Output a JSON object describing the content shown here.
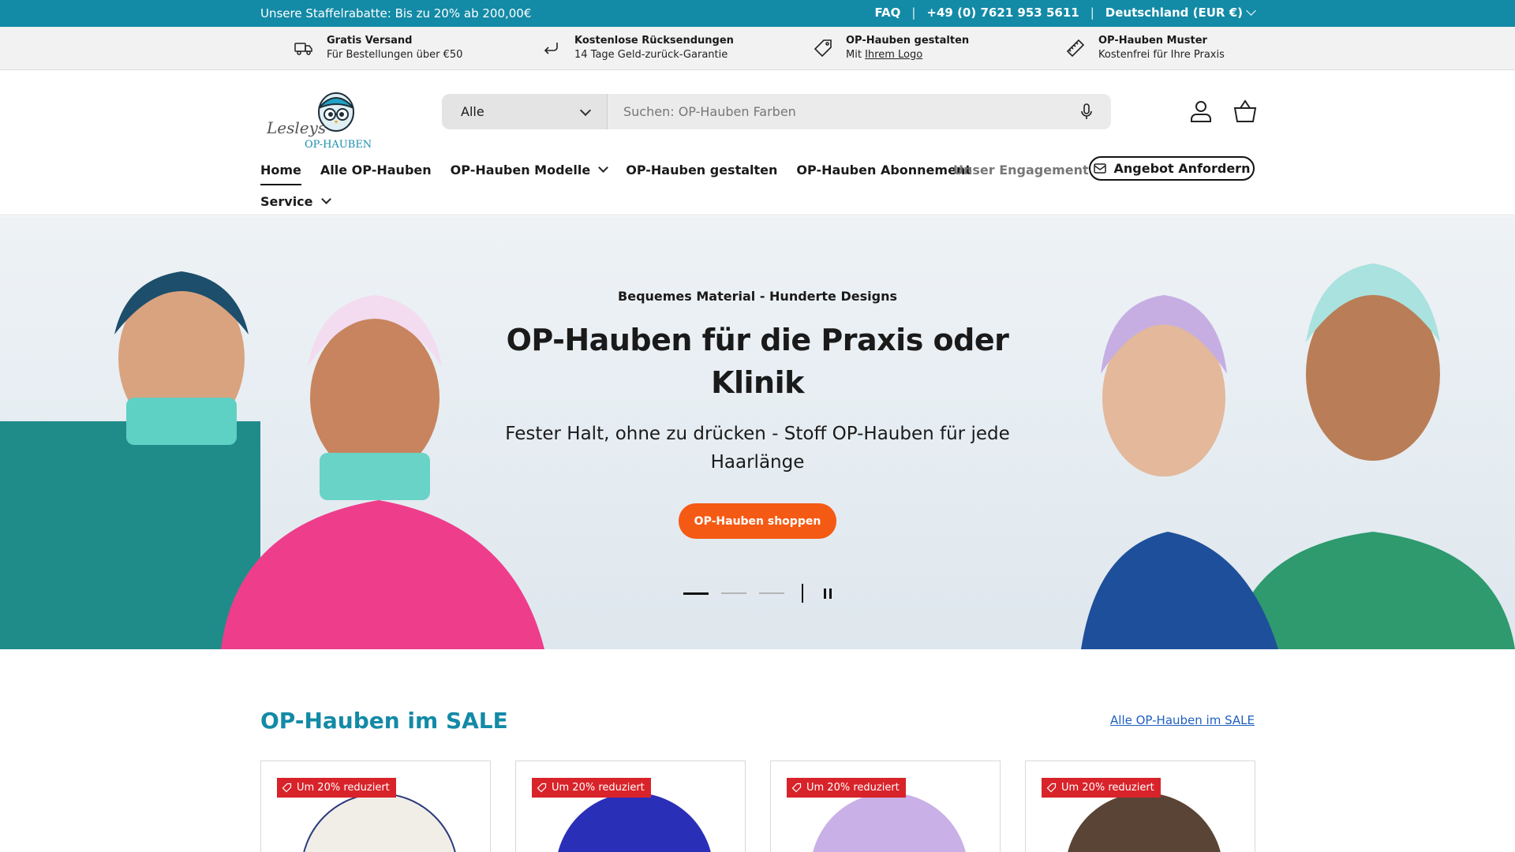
{
  "announcement": {
    "left_text": "Unsere Staffelrabatte: Bis zu 20% ab 200,00€",
    "faq": "FAQ",
    "phone": "+49 (0) 7621 953 5611",
    "country": "Deutschland (EUR €)",
    "separator": "|"
  },
  "usp": [
    {
      "icon": "truck-icon",
      "title": "Gratis Versand",
      "sub": "Für Bestellungen über €50"
    },
    {
      "icon": "return-arrow-icon",
      "title": "Kostenlose Rücksendungen",
      "sub": "14 Tage Geld-zurück-Garantie"
    },
    {
      "icon": "tag-icon",
      "title": "OP-Hauben gestalten",
      "sub_prefix": "Mit ",
      "sub_link": "Ihrem Logo"
    },
    {
      "icon": "ruler-icon",
      "title": "OP-Hauben Muster",
      "sub": "Kostenfrei für Ihre Praxis"
    }
  ],
  "header": {
    "logo_text_1": "Lesleys",
    "logo_text_2": "OP-HAUBEN",
    "search_category": "Alle",
    "search_placeholder": "Suchen: OP-Hauben Farben"
  },
  "nav": {
    "home": "Home",
    "all": "Alle OP-Hauben",
    "models": "OP-Hauben Modelle",
    "design": "OP-Hauben gestalten",
    "subscription": "OP-Hauben Abonnement",
    "engagement": "Unser Engagement",
    "quote": "Angebot Anfordern",
    "service": "Service"
  },
  "hero": {
    "kicker": "Bequemes Material - Hunderte Designs",
    "title": "OP-Hauben für die Praxis oder Klinik",
    "subtitle": "Fester Halt, ohne zu drücken - Stoff OP-Hauben für jede Haarlänge",
    "cta": "OP-Hauben shoppen",
    "slides_total": 3,
    "slide_active": 1
  },
  "sale": {
    "title": "OP-Hauben im SALE",
    "link": "Alle OP-Hauben im SALE",
    "cards": [
      {
        "badge": "Um 20% reduziert",
        "color": "#f1eee8"
      },
      {
        "badge": "Um 20% reduziert",
        "color": "#2a2fb8"
      },
      {
        "badge": "Um 20% reduziert",
        "color": "#c9b0e6"
      },
      {
        "badge": "Um 20% reduziert",
        "color": "#5a4436"
      }
    ]
  },
  "colors": {
    "brand_teal": "#138aa6",
    "cta_orange": "#f55a14",
    "sale_red": "#d8232a"
  }
}
